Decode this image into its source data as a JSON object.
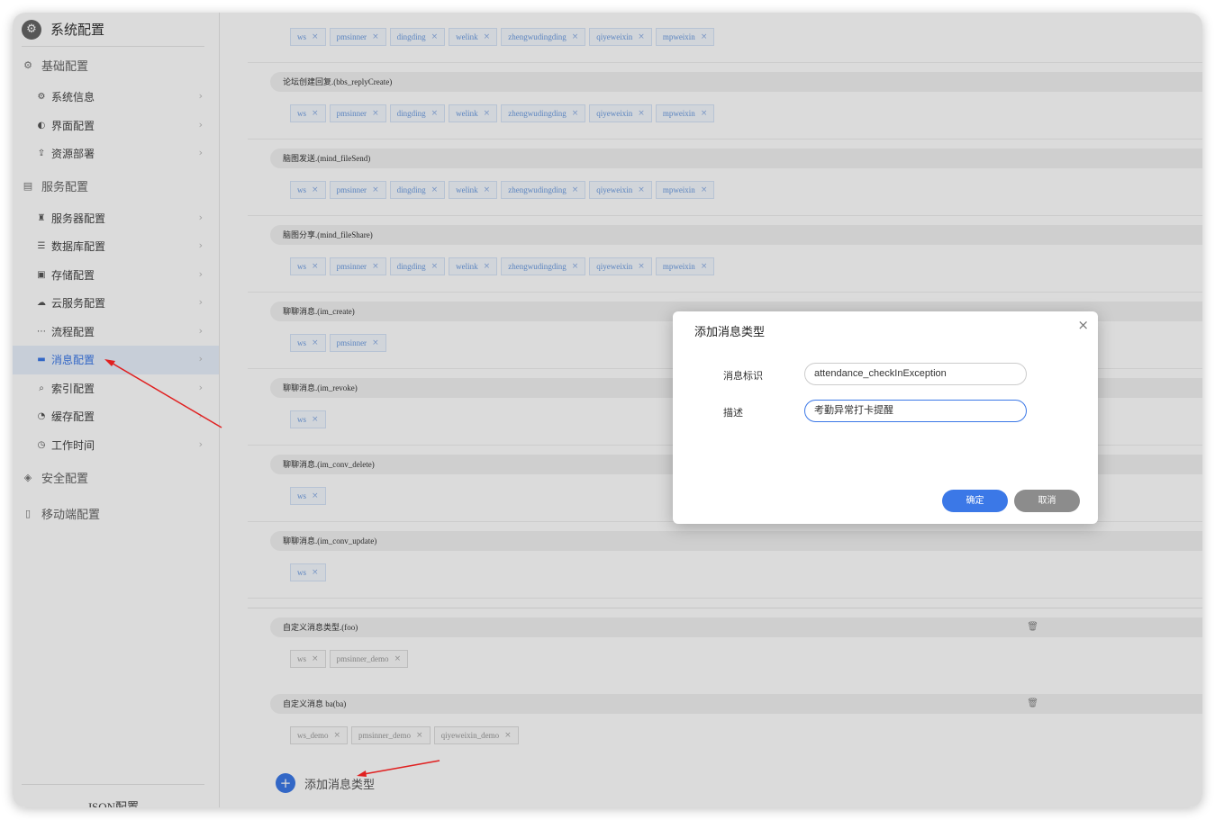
{
  "sidebar": {
    "title": "系统配置",
    "groups": [
      {
        "label": "基础配置",
        "icon": "gear-icon",
        "items": [
          {
            "label": "系统信息",
            "icon": "gear-icon"
          },
          {
            "label": "界面配置",
            "icon": "palette-icon"
          },
          {
            "label": "资源部署",
            "icon": "deploy-icon"
          }
        ]
      },
      {
        "label": "服务配置",
        "icon": "service-icon",
        "items": [
          {
            "label": "服务器配置",
            "icon": "server-icon"
          },
          {
            "label": "数据库配置",
            "icon": "database-icon"
          },
          {
            "label": "存储配置",
            "icon": "storage-icon"
          },
          {
            "label": "云服务配置",
            "icon": "cloud-icon"
          },
          {
            "label": "流程配置",
            "icon": "flow-icon"
          },
          {
            "label": "消息配置",
            "icon": "message-icon",
            "active": true
          },
          {
            "label": "索引配置",
            "icon": "search-icon"
          },
          {
            "label": "缓存配置",
            "icon": "cache-icon"
          },
          {
            "label": "工作时间",
            "icon": "clock-icon"
          }
        ]
      },
      {
        "label": "安全配置",
        "icon": "shield-icon",
        "items": []
      },
      {
        "label": "移动端配置",
        "icon": "mobile-icon",
        "items": []
      }
    ],
    "footer": "JSON配置"
  },
  "main": {
    "sections": [
      {
        "title": "",
        "tags": [
          "ws",
          "pmsinner",
          "dingding",
          "welink",
          "zhengwudingding",
          "qiyeweixin",
          "mpweixin"
        ]
      },
      {
        "title": "论坛创建回复.(bbs_replyCreate)",
        "tags": [
          "ws",
          "pmsinner",
          "dingding",
          "welink",
          "zhengwudingding",
          "qiyeweixin",
          "mpweixin"
        ]
      },
      {
        "title": "脑图发送.(mind_fileSend)",
        "tags": [
          "ws",
          "pmsinner",
          "dingding",
          "welink",
          "zhengwudingding",
          "qiyeweixin",
          "mpweixin"
        ]
      },
      {
        "title": "脑图分享.(mind_fileShare)",
        "tags": [
          "ws",
          "pmsinner",
          "dingding",
          "welink",
          "zhengwudingding",
          "qiyeweixin",
          "mpweixin"
        ]
      },
      {
        "title": "聊聊消息.(im_create)",
        "tags": [
          "ws",
          "pmsinner"
        ]
      },
      {
        "title": "聊聊消息.(im_revoke)",
        "tags": [
          "ws"
        ]
      },
      {
        "title": "聊聊消息.(im_conv_delete)",
        "tags": [
          "ws"
        ]
      },
      {
        "title": "聊聊消息.(im_conv_update)",
        "tags": [
          "ws"
        ]
      }
    ],
    "custom_sections": [
      {
        "title": "自定义消息类型.(foo)",
        "tags": [
          "ws",
          "pmsinner_demo"
        ]
      },
      {
        "title": "自定义消息 ba(ba)",
        "tags": [
          "ws_demo",
          "pmsinner_demo",
          "qiyeweixin_demo"
        ]
      }
    ],
    "add_label": "添加消息类型",
    "tag_close_glyph": "×"
  },
  "modal": {
    "title": "添加消息类型",
    "close_glyph": "×",
    "fields": [
      {
        "label": "消息标识",
        "value": "attendance_checkInException"
      },
      {
        "label": "描述",
        "value": "考勤异常打卡提醒"
      }
    ],
    "confirm_label": "确定",
    "cancel_label": "取消"
  },
  "colors": {
    "accent": "#3b78e7",
    "annotation_arrow": "#e02020"
  }
}
